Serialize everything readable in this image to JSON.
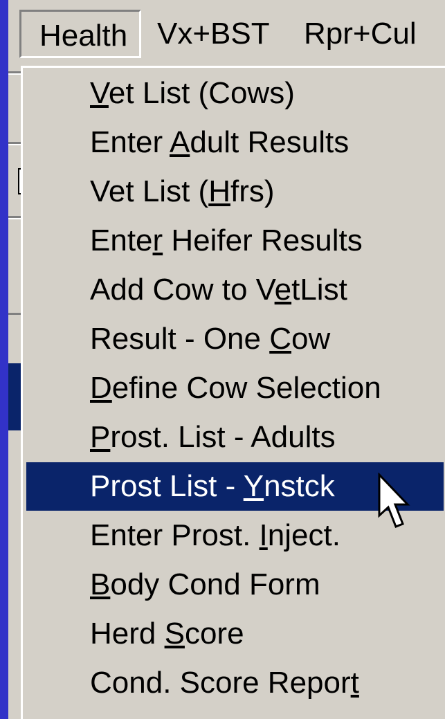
{
  "menubar": {
    "items": [
      {
        "label": "Health",
        "active": true
      },
      {
        "label": "Vx+BST",
        "active": false
      },
      {
        "label": "Rpr+Cul",
        "active": false
      }
    ]
  },
  "dropdown": {
    "items": [
      {
        "pre": "",
        "key": "V",
        "post": "et List (Cows)"
      },
      {
        "pre": "Enter ",
        "key": "A",
        "post": "dult Results"
      },
      {
        "pre": "Vet List (",
        "key": "H",
        "post": "frs)"
      },
      {
        "pre": "Ente",
        "key": "r",
        "post": " Heifer Results"
      },
      {
        "pre": "Add Cow to V",
        "key": "e",
        "post": "tList"
      },
      {
        "pre": "Result - One ",
        "key": "C",
        "post": "ow"
      },
      {
        "pre": "",
        "key": "D",
        "post": "efine Cow Selection"
      },
      {
        "pre": "",
        "key": "P",
        "post": "rost. List - Adults"
      },
      {
        "pre": "Prost List - ",
        "key": "Y",
        "post": "nstck"
      },
      {
        "pre": "Enter Prost. ",
        "key": "I",
        "post": "nject."
      },
      {
        "pre": "",
        "key": "B",
        "post": "ody Cond Form"
      },
      {
        "pre": "Herd ",
        "key": "S",
        "post": "core"
      },
      {
        "pre": "Cond. Score Repor",
        "key": "t",
        "post": ""
      }
    ],
    "selected_index": 8
  },
  "colors": {
    "desktop": "#3232c8",
    "face": "#d4d0c8",
    "highlight": "#0a246a"
  },
  "icons": {
    "cursor": "arrow-pointer-icon"
  }
}
